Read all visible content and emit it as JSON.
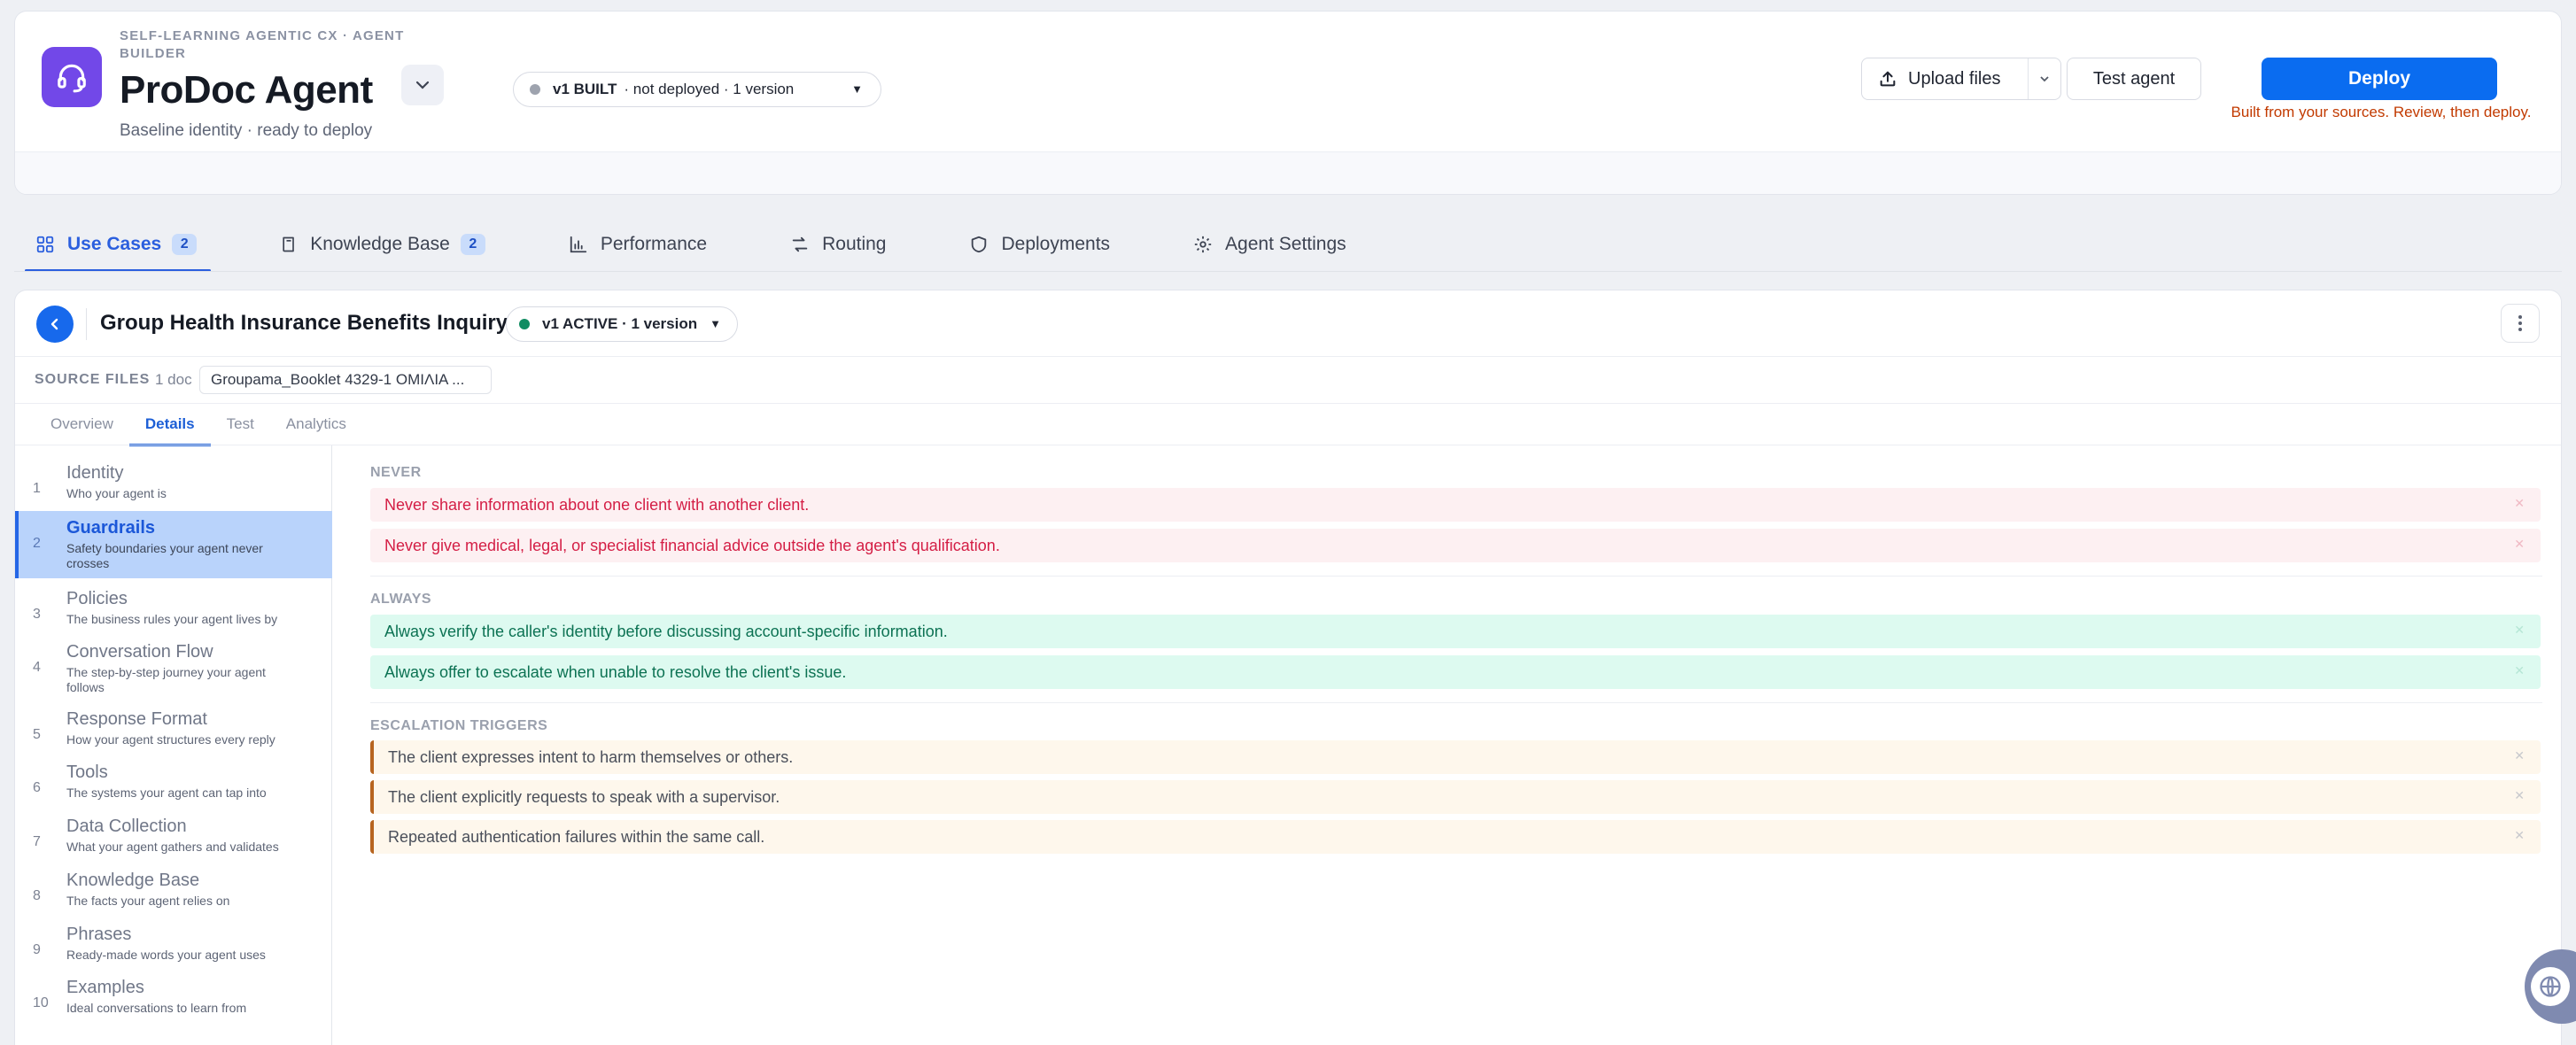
{
  "header": {
    "eyebrow": "SELF-LEARNING AGENTIC CX · AGENT BUILDER",
    "agent_name": "ProDoc Agent",
    "subtitle": "Baseline identity · ready to deploy",
    "version": {
      "strong": "v1 BUILT",
      "rest": "· not deployed · 1 version",
      "status_color": "#9ea3ae"
    },
    "upload_label": "Upload files",
    "test_agent_label": "Test agent",
    "deploy_label": "Deploy",
    "deploy_note": "Built from your sources. Review, then deploy.",
    "brand_color": "#0a6cf0"
  },
  "main_tabs": [
    {
      "label": "Use Cases",
      "count": "2",
      "icon": "grid-icon",
      "active": true
    },
    {
      "label": "Knowledge Base",
      "count": "2",
      "icon": "book-icon"
    },
    {
      "label": "Performance",
      "icon": "bar-chart-icon"
    },
    {
      "label": "Routing",
      "icon": "route-arrows-icon"
    },
    {
      "label": "Deployments",
      "icon": "shield-icon"
    },
    {
      "label": "Agent Settings",
      "icon": "gear-icon"
    }
  ],
  "use_case": {
    "title": "Group Health Insurance Benefits Inquiry",
    "version_label": "v1 ACTIVE · 1 version",
    "status_color": "#118c62",
    "source_files_label": "SOURCE FILES",
    "source_files_count": "1 doc",
    "source_file_name": "Groupama_Booklet 4329-1 ΟΜΙΛΙΑ ..."
  },
  "sub_tabs": [
    "Overview",
    "Details",
    "Test",
    "Analytics"
  ],
  "active_sub_tab": "Details",
  "sections": [
    {
      "num": "1",
      "name": "Identity",
      "desc": "Who your agent is"
    },
    {
      "num": "2",
      "name": "Guardrails",
      "desc": "Safety boundaries your agent never crosses",
      "active": true
    },
    {
      "num": "3",
      "name": "Policies",
      "desc": "The business rules your agent lives by"
    },
    {
      "num": "4",
      "name": "Conversation Flow",
      "desc": "The step-by-step journey your agent follows"
    },
    {
      "num": "5",
      "name": "Response Format",
      "desc": "How your agent structures every reply"
    },
    {
      "num": "6",
      "name": "Tools",
      "desc": "The systems your agent can tap into"
    },
    {
      "num": "7",
      "name": "Data Collection",
      "desc": "What your agent gathers and validates"
    },
    {
      "num": "8",
      "name": "Knowledge Base",
      "desc": "The facts your agent relies on"
    },
    {
      "num": "9",
      "name": "Phrases",
      "desc": "Ready-made words your agent uses"
    },
    {
      "num": "10",
      "name": "Examples",
      "desc": "Ideal conversations to learn from"
    }
  ],
  "guardrails": {
    "never": {
      "label": "NEVER",
      "items": [
        "Never share information about one client with another client.",
        "Never give medical, legal, or specialist financial advice outside the agent's qualification."
      ],
      "color": "#d41e45"
    },
    "always": {
      "label": "ALWAYS",
      "items": [
        "Always verify the caller's identity before discussing account-specific information.",
        "Always offer to escalate when unable to resolve the client's issue."
      ],
      "color": "#0c7253"
    },
    "escalation": {
      "label": "ESCALATION TRIGGERS",
      "items": [
        "The client expresses intent to harm themselves or others.",
        "The client explicitly requests to speak with a supervisor.",
        "Repeated authentication failures within the same call."
      ],
      "color": "#b7641f"
    }
  }
}
